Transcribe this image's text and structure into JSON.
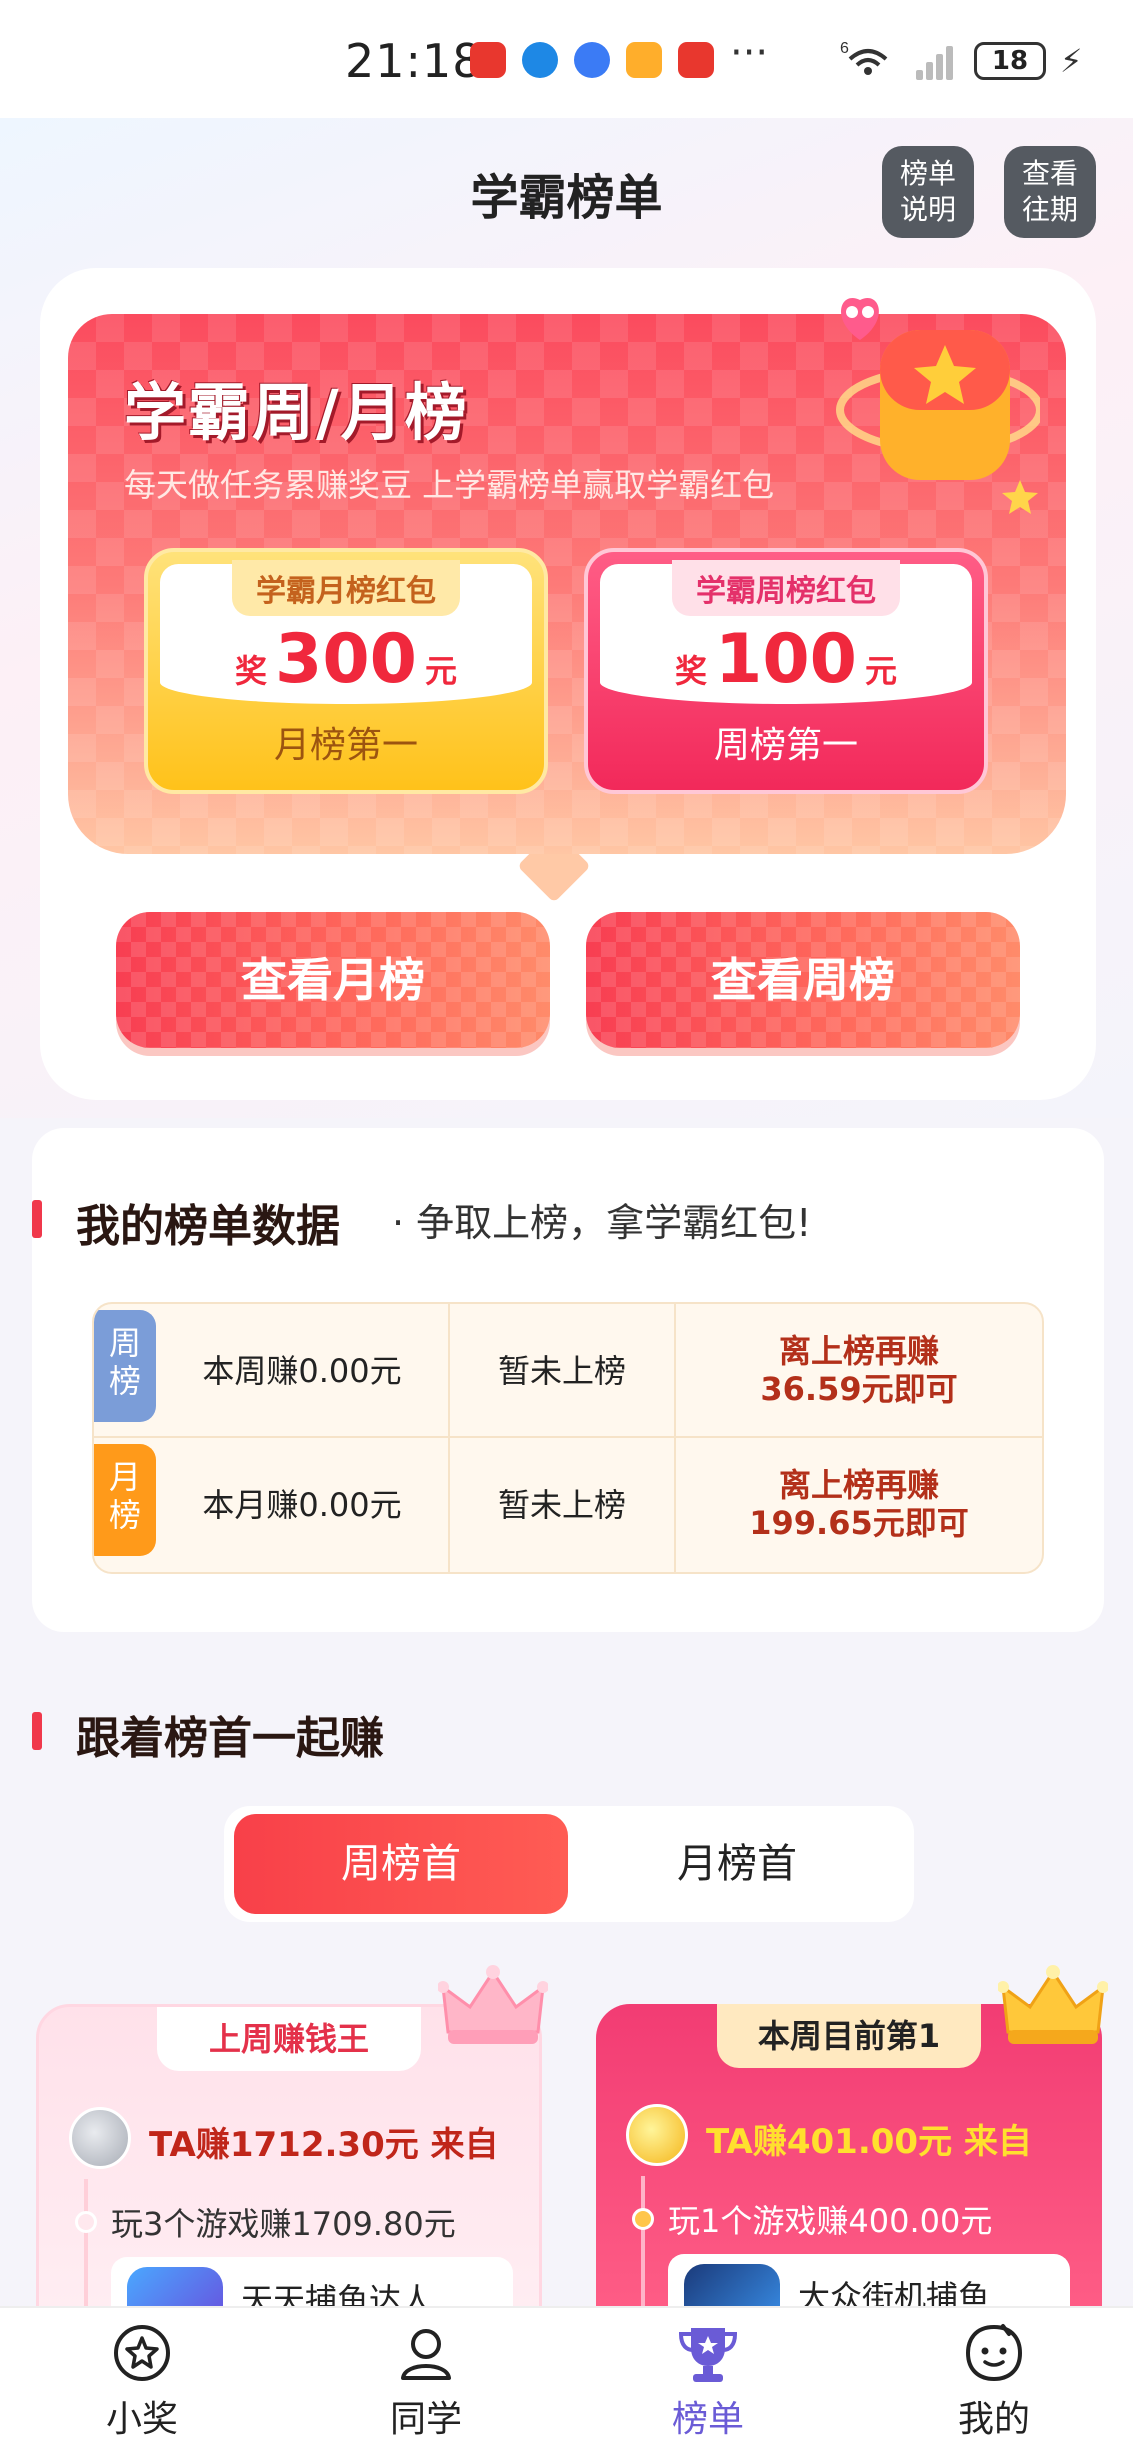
{
  "status_bar": {
    "time": "21:18",
    "more": "···",
    "network": "6",
    "battery": "18",
    "notification_icons": [
      "huawei-app-icon",
      "browser-icon",
      "quark-icon",
      "game-icon",
      "huawei-app-icon"
    ]
  },
  "header": {
    "title": "学霸榜单",
    "rules_button": [
      "榜单",
      "说明"
    ],
    "history_button": [
      "查看",
      "往期"
    ]
  },
  "hero": {
    "title": "学霸周/月榜",
    "subtitle": "每天做任务累赚奖豆 上学霸榜单赢取学霸红包",
    "month_prize": {
      "tag": "学霸月榜红包",
      "prefix": "奖",
      "amount": "300",
      "unit": "元",
      "rank": "月榜第一"
    },
    "week_prize": {
      "tag": "学霸周榜红包",
      "prefix": "奖",
      "amount": "100",
      "unit": "元",
      "rank": "周榜第一"
    },
    "view_month_button": "查看月榜",
    "view_week_button": "查看周榜"
  },
  "my_data": {
    "title": "我的榜单数据",
    "subtitle": "· 争取上榜，拿学霸红包!",
    "rows": [
      {
        "badge": [
          "周",
          "榜"
        ],
        "earned": "本周赚0.00元",
        "status": "暂未上榜",
        "hint_line1": "离上榜再赚",
        "hint_line2": "36.59元即可"
      },
      {
        "badge": [
          "月",
          "榜"
        ],
        "earned": "本月赚0.00元",
        "status": "暂未上榜",
        "hint_line1": "离上榜再赚",
        "hint_line2": "199.65元即可"
      }
    ]
  },
  "follow": {
    "title": "跟着榜首一起赚",
    "tabs": [
      "周榜首",
      "月榜首"
    ],
    "active_tab": 0,
    "leaders": [
      {
        "tag": "上周赚钱王",
        "earn": "TA赚1712.30元 来自",
        "detail": "玩3个游戏赚1709.80元",
        "game": "天天捕鱼达人"
      },
      {
        "tag": "本周目前第1",
        "earn": "TA赚401.00元 来自",
        "detail": "玩1个游戏赚400.00元",
        "game": "大众街机捕鱼"
      }
    ]
  },
  "bottom_nav": [
    {
      "label": "小奖",
      "icon": "star-icon"
    },
    {
      "label": "同学",
      "icon": "person-icon"
    },
    {
      "label": "榜单",
      "icon": "trophy-icon",
      "active": true
    },
    {
      "label": "我的",
      "icon": "face-icon"
    }
  ],
  "colors": {
    "accent": "#f0384b",
    "nav_active": "#6a5bd6",
    "hero_red": "#fb4b5e"
  }
}
